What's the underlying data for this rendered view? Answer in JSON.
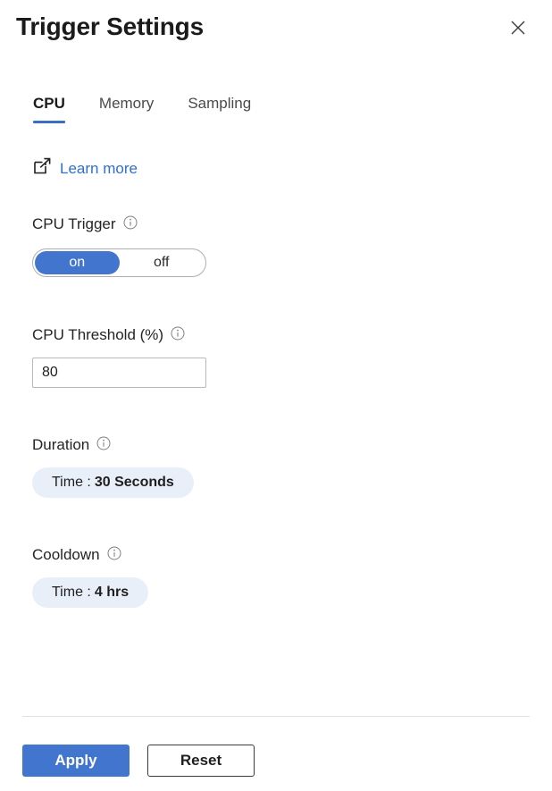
{
  "header": {
    "title": "Trigger Settings",
    "close_label": "Close",
    "close_icon": "close-icon"
  },
  "tabs": [
    {
      "label": "CPU",
      "active": true
    },
    {
      "label": "Memory",
      "active": false
    },
    {
      "label": "Sampling",
      "active": false
    }
  ],
  "learn_more": {
    "label": "Learn more",
    "icon": "external-link-icon",
    "color": "#2f6fd0"
  },
  "fields": {
    "cpu_trigger": {
      "label": "CPU Trigger",
      "info_icon": "info-icon",
      "options": [
        "on",
        "off"
      ],
      "selected": "on"
    },
    "cpu_threshold": {
      "label": "CPU Threshold (%)",
      "info_icon": "info-icon",
      "value": "80",
      "placeholder": ""
    },
    "duration": {
      "label": "Duration",
      "info_icon": "info-icon",
      "pill_key": "Time :",
      "pill_value": "30 Seconds"
    },
    "cooldown": {
      "label": "Cooldown",
      "info_icon": "info-icon",
      "pill_key": "Time :",
      "pill_value": "4 hrs"
    }
  },
  "footer": {
    "apply_label": "Apply",
    "reset_label": "Reset"
  },
  "colors": {
    "accent": "#4276ce",
    "link": "#2f6fd0",
    "pill_bg": "#e9eff8",
    "tab_underline": "#3a6fc4",
    "text": "#242424"
  }
}
